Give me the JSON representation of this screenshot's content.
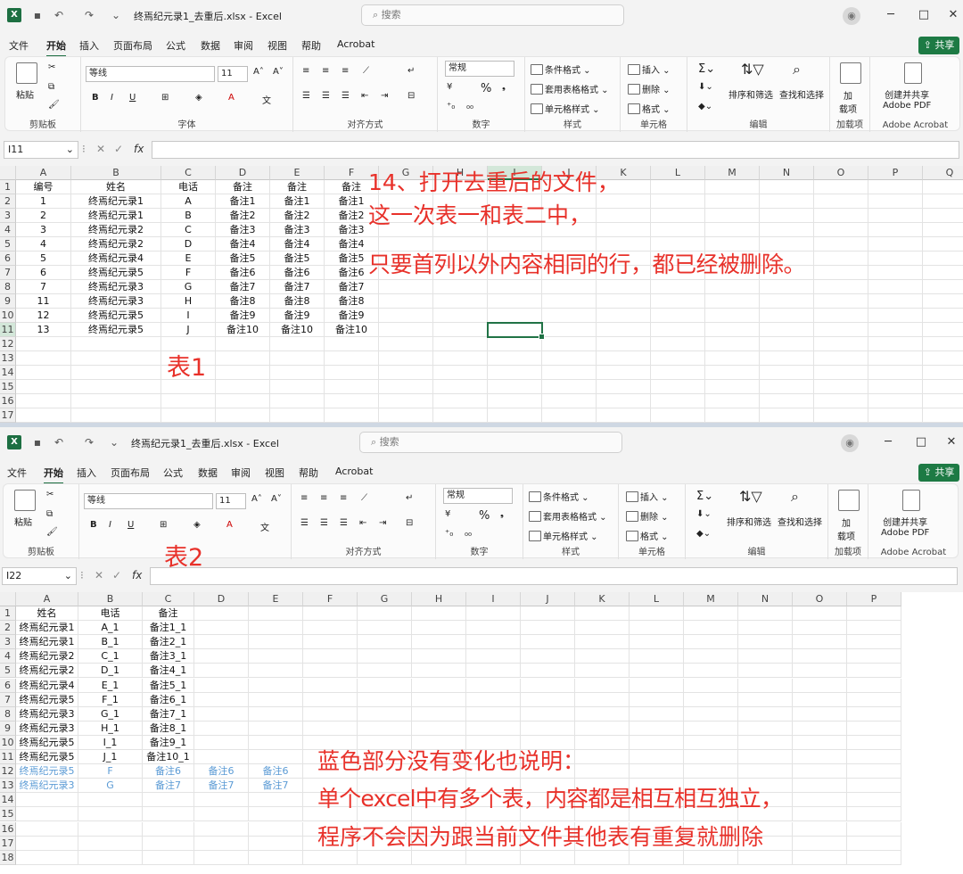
{
  "window1": {
    "title": "终焉纪元录1_去重后.xlsx  -  Excel",
    "search_placeholder": "搜索",
    "name_box": "I11",
    "menu": [
      "文件",
      "开始",
      "插入",
      "页面布局",
      "公式",
      "数据",
      "审阅",
      "视图",
      "帮助",
      "Acrobat"
    ],
    "share": "共享",
    "columns": [
      "A",
      "B",
      "C",
      "D",
      "E",
      "F",
      "G",
      "H",
      "I",
      "J",
      "K",
      "L",
      "M",
      "N",
      "O",
      "P",
      "Q"
    ],
    "rows": [
      "1",
      "2",
      "3",
      "4",
      "5",
      "6",
      "7",
      "8",
      "9",
      "10",
      "11",
      "12",
      "13",
      "14",
      "15",
      "16",
      "17"
    ],
    "cells": [
      [
        "编号",
        "姓名",
        "电话",
        "备注",
        "备注",
        "备注"
      ],
      [
        "1",
        "终焉纪元录1",
        "A",
        "备注1",
        "备注1",
        "备注1"
      ],
      [
        "2",
        "终焉纪元录1",
        "B",
        "备注2",
        "备注2",
        "备注2"
      ],
      [
        "3",
        "终焉纪元录2",
        "C",
        "备注3",
        "备注3",
        "备注3"
      ],
      [
        "4",
        "终焉纪元录2",
        "D",
        "备注4",
        "备注4",
        "备注4"
      ],
      [
        "5",
        "终焉纪元录4",
        "E",
        "备注5",
        "备注5",
        "备注5"
      ],
      [
        "6",
        "终焉纪元录5",
        "F",
        "备注6",
        "备注6",
        "备注6"
      ],
      [
        "7",
        "终焉纪元录3",
        "G",
        "备注7",
        "备注7",
        "备注7"
      ],
      [
        "11",
        "终焉纪元录3",
        "H",
        "备注8",
        "备注8",
        "备注8"
      ],
      [
        "12",
        "终焉纪元录5",
        "I",
        "备注9",
        "备注9",
        "备注9"
      ],
      [
        "13",
        "终焉纪元录5",
        "J",
        "备注10",
        "备注10",
        "备注10"
      ]
    ]
  },
  "window2": {
    "title": "终焉纪元录1_去重后.xlsx  -  Excel",
    "search_placeholder": "搜索",
    "name_box": "I22",
    "menu": [
      "文件",
      "开始",
      "插入",
      "页面布局",
      "公式",
      "数据",
      "审阅",
      "视图",
      "帮助",
      "Acrobat"
    ],
    "share": "共享",
    "columns": [
      "A",
      "B",
      "C",
      "D",
      "E",
      "F",
      "G",
      "H",
      "I",
      "J",
      "K",
      "L",
      "M",
      "N",
      "O",
      "P"
    ],
    "rows": [
      "1",
      "2",
      "3",
      "4",
      "5",
      "6",
      "7",
      "8",
      "9",
      "10",
      "11",
      "12",
      "13",
      "14",
      "15",
      "16",
      "17",
      "18"
    ],
    "cells": [
      [
        "姓名",
        "电话",
        "备注",
        "",
        "",
        ""
      ],
      [
        "终焉纪元录1",
        "A_1",
        "备注1_1",
        "",
        "",
        ""
      ],
      [
        "终焉纪元录1",
        "B_1",
        "备注2_1",
        "",
        "",
        ""
      ],
      [
        "终焉纪元录2",
        "C_1",
        "备注3_1",
        "",
        "",
        ""
      ],
      [
        "终焉纪元录2",
        "D_1",
        "备注4_1",
        "",
        "",
        ""
      ],
      [
        "终焉纪元录4",
        "E_1",
        "备注5_1",
        "",
        "",
        ""
      ],
      [
        "终焉纪元录5",
        "F_1",
        "备注6_1",
        "",
        "",
        ""
      ],
      [
        "终焉纪元录3",
        "G_1",
        "备注7_1",
        "",
        "",
        ""
      ],
      [
        "终焉纪元录3",
        "H_1",
        "备注8_1",
        "",
        "",
        ""
      ],
      [
        "终焉纪元录5",
        "I_1",
        "备注9_1",
        "",
        "",
        ""
      ],
      [
        "终焉纪元录5",
        "J_1",
        "备注10_1",
        "",
        "",
        ""
      ],
      [
        "终焉纪元录5",
        "F",
        "备注6",
        "备注6",
        "备注6",
        ""
      ],
      [
        "终焉纪元录3",
        "G",
        "备注7",
        "备注7",
        "备注7",
        ""
      ]
    ]
  },
  "ribbon": {
    "paste": "粘贴",
    "clipboard": "剪贴板",
    "font_name": "等线",
    "font_size": "11",
    "font_group": "字体",
    "align_group": "对齐方式",
    "number_format": "常规",
    "number_group": "数字",
    "cond_format": "条件格式",
    "table_format": "套用表格格式",
    "cell_style": "单元格样式",
    "style_group": "样式",
    "insert": "插入",
    "delete": "删除",
    "format": "格式",
    "cells_group": "单元格",
    "sort_filter": "排序和筛选",
    "find_select": "查找和选择",
    "edit_group": "编辑",
    "addin": "加载项",
    "addin_label": "加\n载项",
    "create_share": "创建并共享\nAdobe PDF",
    "acrobat_group": "Adobe Acrobat"
  },
  "annotations": {
    "top_line1": "14、打开去重后的文件，",
    "top_line2": "这一次表一和表二中，",
    "top_line3": "只要首列以外内容相同的行，都已经被删除。",
    "table1": "表1",
    "table2": "表2",
    "bottom_line1": "蓝色部分没有变化也说明：",
    "bottom_line2": "单个excel中有多个表，内容都是相互相互独立，",
    "bottom_line3": "程序不会因为跟当前文件其他表有重复就删除"
  },
  "colors": {
    "excel_green": "#1d6f42",
    "annotation_red": "#e8312a",
    "unchanged_blue": "#5b9bd5"
  }
}
